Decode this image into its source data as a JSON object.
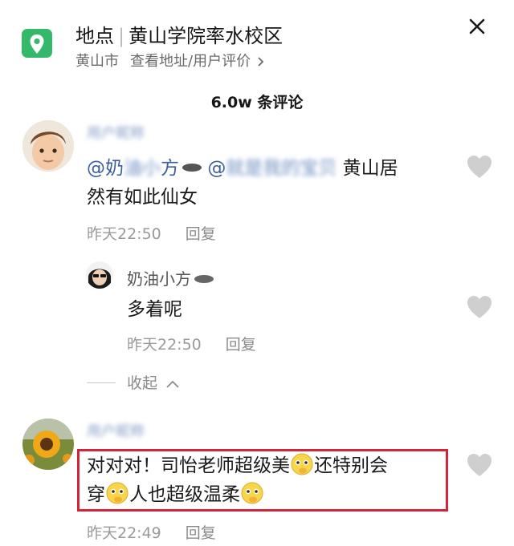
{
  "location": {
    "label": "地点",
    "name": "黄山学院率水校区",
    "city": "黄山市",
    "link": "查看地址/用户评价"
  },
  "comment_count": "6.0w 条评论",
  "comments": [
    {
      "name": "用户昵称",
      "mention1_visible": "@奶",
      "mention1_blurred": "油小",
      "mention1_end": "方",
      "mention2_visible": "@",
      "mention2_blurred": "就是我的宝贝",
      "line1_tail": " 黄山居",
      "line2": "然有如此仙女",
      "time": "昨天22:50",
      "reply": "回复"
    },
    {
      "name": "奶油小方",
      "text": "多着呢",
      "time": "昨天22:50",
      "reply": "回复"
    },
    {
      "name": "用户昵称",
      "line1_a": "对对对！司怡老师超级美",
      "line1_b": "还特别会",
      "line2_a": "穿",
      "line2_b": "人也超级温柔",
      "time": "昨天22:49",
      "reply": "回复"
    }
  ],
  "collapse_label": "收起",
  "icons": {
    "location": "map-pin-icon",
    "close": "close-icon",
    "like": "heart-icon",
    "collapse": "chevron-up-icon",
    "emoji": "pleading-face-emoji-icon"
  },
  "colors": {
    "location_green": "#34b96a",
    "mention_blue": "#3a5f9b",
    "highlight_red": "#d3243a",
    "heart_gray": "#cfcfcf"
  }
}
